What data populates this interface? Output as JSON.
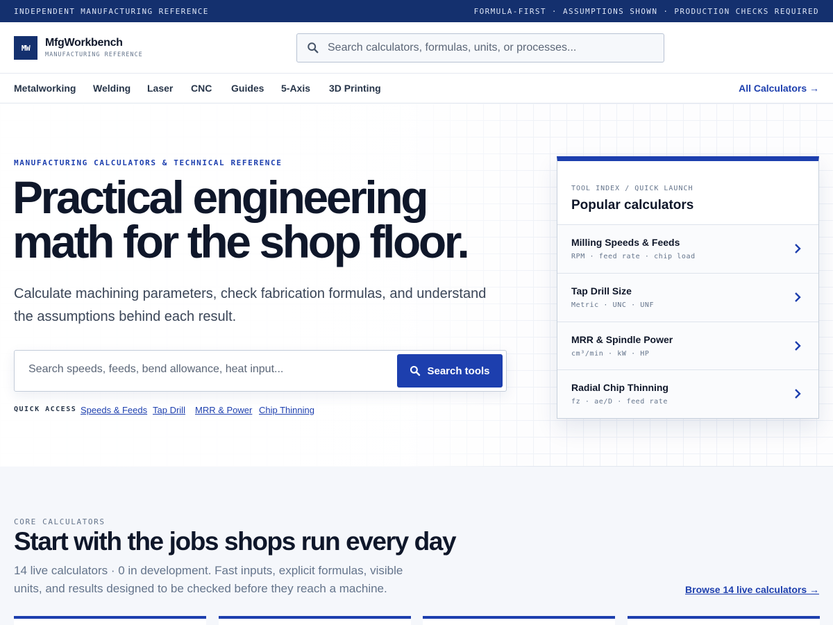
{
  "topbar": {
    "left": "INDEPENDENT MANUFACTURING REFERENCE",
    "right": "FORMULA-FIRST · ASSUMPTIONS SHOWN · PRODUCTION CHECKS REQUIRED"
  },
  "header": {
    "logo_initials": "MW",
    "brand_name": "MfgWorkbench",
    "brand_sub": "MANUFACTURING REFERENCE",
    "search_placeholder": "Search calculators, formulas, units, or processes..."
  },
  "nav": {
    "items": [
      "Metalworking",
      "Welding",
      "Laser",
      "CNC",
      "Guides",
      "5-Axis",
      "3D Printing"
    ],
    "all_calculators": "All Calculators →"
  },
  "hero": {
    "eyebrow": "MANUFACTURING CALCULATORS & TECHNICAL REFERENCE",
    "title_line1": "Practical engineering",
    "title_line2": "math for the shop floor.",
    "subtitle": "Calculate machining parameters, check fabrication formulas, and understand the assumptions behind each result.",
    "search_placeholder": "Search speeds, feeds, bend allowance, heat input...",
    "search_button": "Search tools",
    "quick_label": "QUICK ACCESS",
    "quick_links": [
      "Speeds & Feeds",
      "Tap Drill",
      "MRR & Power",
      "Chip Thinning"
    ]
  },
  "popular": {
    "eyebrow": "TOOL INDEX / QUICK LAUNCH",
    "title": "Popular calculators",
    "items": [
      {
        "title": "Milling Speeds & Feeds",
        "sub": "RPM · feed rate · chip load"
      },
      {
        "title": "Tap Drill Size",
        "sub": "Metric · UNC · UNF"
      },
      {
        "title": "MRR & Spindle Power",
        "sub": "cm³/min · kW · HP"
      },
      {
        "title": "Radial Chip Thinning",
        "sub": "fz · ae/D · feed rate"
      }
    ]
  },
  "core": {
    "eyebrow": "CORE CALCULATORS",
    "title": "Start with the jobs shops run every day",
    "description": "14 live calculators · 0 in development. Fast inputs, explicit formulas, visible units, and results designed to be checked before they reach a machine.",
    "browse_link": "Browse 14 live calculators →"
  },
  "icons": {
    "search": "search-icon",
    "chevron": "chevron-right-icon"
  },
  "colors": {
    "brand_navy": "#14306e",
    "accent_blue": "#1d3fae",
    "text_dark": "#0f172a",
    "muted": "#64748b"
  }
}
